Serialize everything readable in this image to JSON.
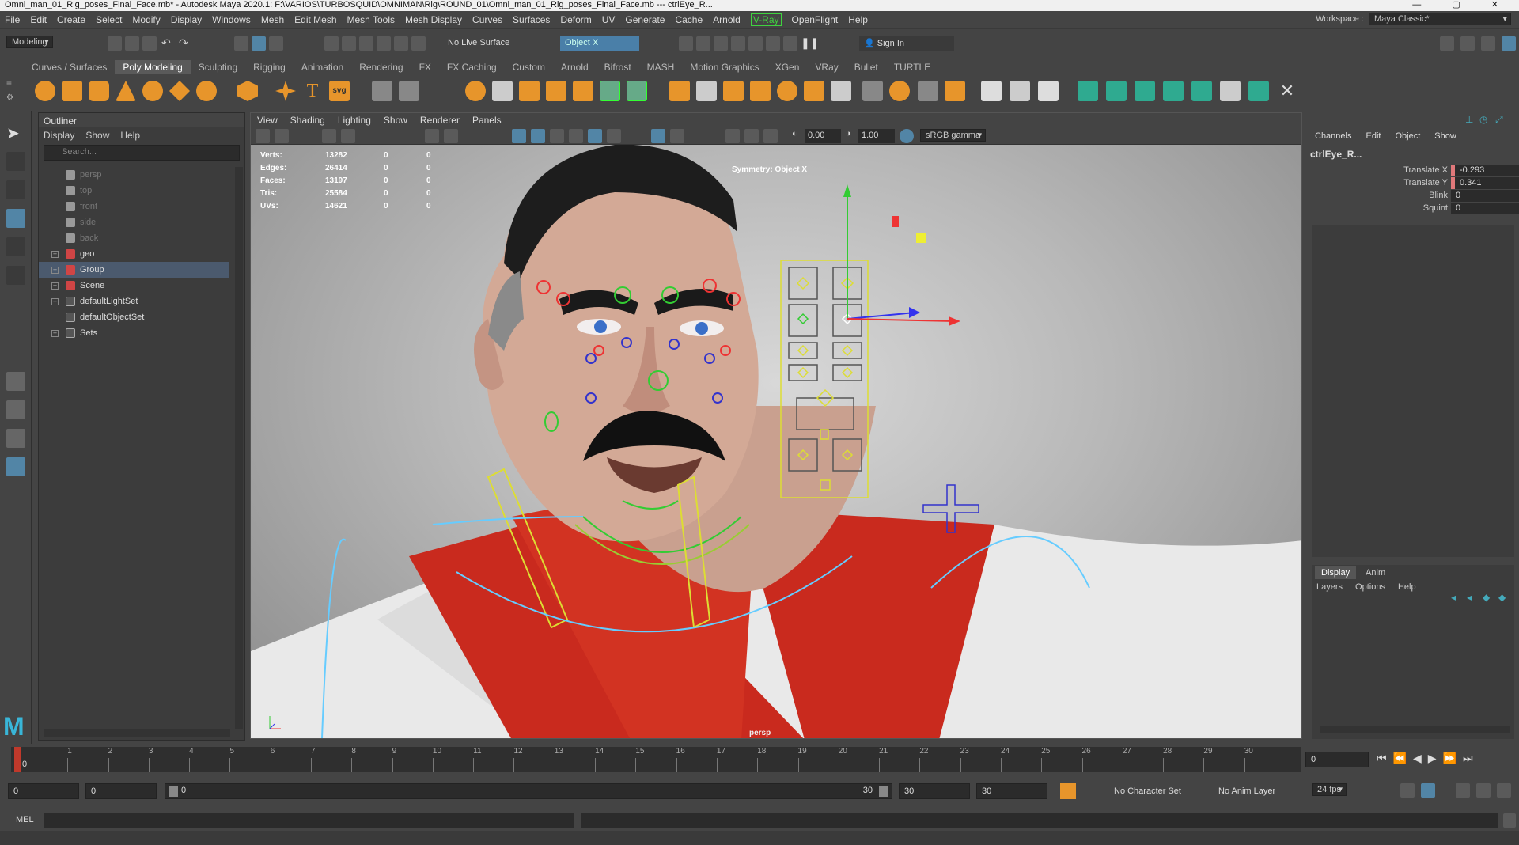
{
  "window": {
    "title": "Omni_man_01_Rig_poses_Final_Face.mb* - Autodesk Maya 2020.1: F:\\VARIOS\\TURBOSQUID\\OMNIMAN\\Rig\\ROUND_01\\Omni_man_01_Rig_poses_Final_Face.mb  ---  ctrlEye_R..."
  },
  "menubar": {
    "items": [
      "File",
      "Edit",
      "Create",
      "Select",
      "Modify",
      "Display",
      "Windows",
      "Mesh",
      "Edit Mesh",
      "Mesh Tools",
      "Mesh Display",
      "Curves",
      "Surfaces",
      "Deform",
      "UV",
      "Generate",
      "Cache",
      "Arnold",
      "V-Ray",
      "OpenFlight",
      "Help"
    ],
    "workspace_label": "Workspace :",
    "workspace_value": "Maya Classic*"
  },
  "statusline": {
    "mode": "Modeling",
    "live_surface": "No Live Surface",
    "symmetry": "Object X",
    "sign_in": "Sign In"
  },
  "shelf": {
    "tabs": [
      "Curves / Surfaces",
      "Poly Modeling",
      "Sculpting",
      "Rigging",
      "Animation",
      "Rendering",
      "FX",
      "FX Caching",
      "Custom",
      "Arnold",
      "Bifrost",
      "MASH",
      "Motion Graphics",
      "XGen",
      "VRay",
      "Bullet",
      "TURTLE"
    ],
    "active_tab": "Poly Modeling",
    "svg_label": "svg"
  },
  "outliner": {
    "title": "Outliner",
    "menu": [
      "Display",
      "Show",
      "Help"
    ],
    "search_placeholder": "Search...",
    "items": [
      {
        "label": "persp",
        "type": "camera",
        "dim": true
      },
      {
        "label": "top",
        "type": "camera",
        "dim": true
      },
      {
        "label": "front",
        "type": "camera",
        "dim": true
      },
      {
        "label": "side",
        "type": "camera",
        "dim": true
      },
      {
        "label": "back",
        "type": "camera",
        "dim": true
      },
      {
        "label": "geo",
        "type": "group",
        "expandable": true
      },
      {
        "label": "Group",
        "type": "group",
        "expandable": true,
        "selected": true
      },
      {
        "label": "Scene",
        "type": "group",
        "expandable": true
      },
      {
        "label": "defaultLightSet",
        "type": "set",
        "expandable": true
      },
      {
        "label": "defaultObjectSet",
        "type": "set"
      },
      {
        "label": "Sets",
        "type": "set",
        "expandable": true
      }
    ]
  },
  "viewport": {
    "menu": [
      "View",
      "Shading",
      "Lighting",
      "Show",
      "Renderer",
      "Panels"
    ],
    "exposure": "0.00",
    "gamma": "1.00",
    "color_space": "sRGB gamma",
    "symmetry_hud": "Symmetry: Object X",
    "camera": "persp",
    "stats": [
      {
        "label": "Verts:",
        "v1": "13282",
        "v2": "0",
        "v3": "0"
      },
      {
        "label": "Edges:",
        "v1": "26414",
        "v2": "0",
        "v3": "0"
      },
      {
        "label": "Faces:",
        "v1": "13197",
        "v2": "0",
        "v3": "0"
      },
      {
        "label": "Tris:",
        "v1": "25584",
        "v2": "0",
        "v3": "0"
      },
      {
        "label": "UVs:",
        "v1": "14621",
        "v2": "0",
        "v3": "0"
      }
    ]
  },
  "channelbox": {
    "menu": [
      "Channels",
      "Edit",
      "Object",
      "Show"
    ],
    "object_name": "ctrlEye_R...",
    "channels": [
      {
        "label": "Translate X",
        "value": "-0.293",
        "keyed": true
      },
      {
        "label": "Translate Y",
        "value": "0.341",
        "keyed": true
      },
      {
        "label": "Blink",
        "value": "0",
        "keyed": false
      },
      {
        "label": "Squint",
        "value": "0",
        "keyed": false
      }
    ],
    "layer_tabs": [
      "Display",
      "Anim"
    ],
    "layer_menu": [
      "Layers",
      "Options",
      "Help"
    ]
  },
  "timeline": {
    "ticks": [
      "1",
      "2",
      "3",
      "4",
      "5",
      "6",
      "7",
      "8",
      "9",
      "10",
      "11",
      "12",
      "13",
      "14",
      "15",
      "16",
      "17",
      "18",
      "19",
      "20",
      "21",
      "22",
      "23",
      "24",
      "25",
      "26",
      "27",
      "28",
      "29",
      "30"
    ],
    "current_frame": "0",
    "current_frame_field": "0"
  },
  "range": {
    "start": "0",
    "anim_start": "0",
    "slider_start": "0",
    "slider_end": "30",
    "anim_end": "30",
    "end": "30",
    "character_set": "No Character Set",
    "anim_layer": "No Anim Layer",
    "fps": "24 fps"
  },
  "command": {
    "language": "MEL"
  }
}
